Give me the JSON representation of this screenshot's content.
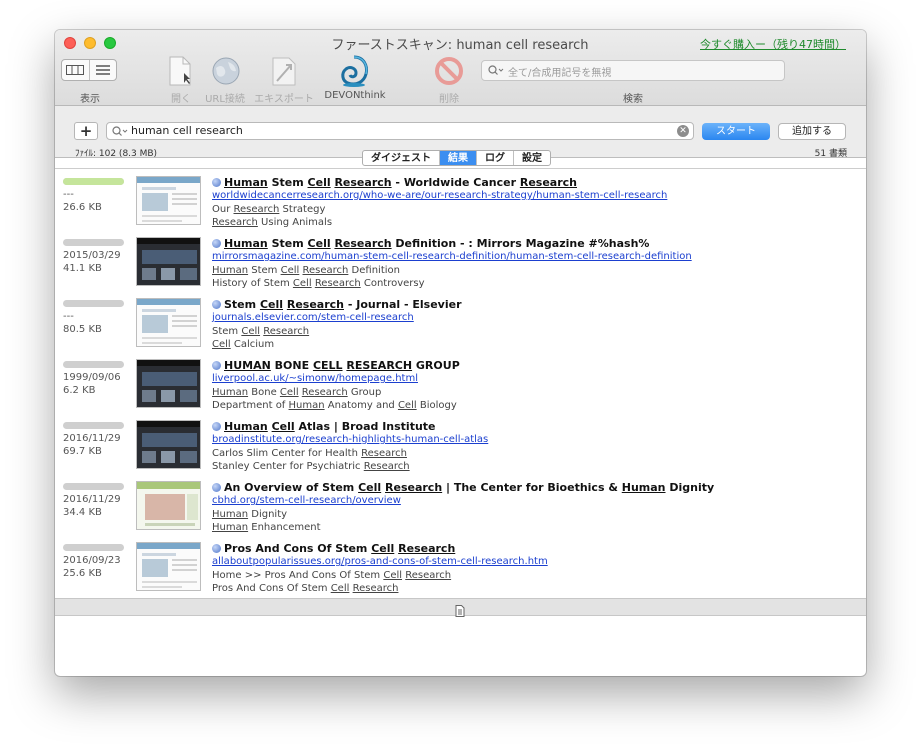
{
  "window": {
    "title": "ファーストスキャン: human cell research",
    "buy_link": "今すぐ購入ー（残り47時間）"
  },
  "toolbar": {
    "view_label": "表示",
    "open_label": "開く",
    "url_label": "URL接続",
    "export_label": "エキスポート",
    "devonthink_label": "DEVONthink",
    "delete_label": "削除",
    "search_label": "検索",
    "search_placeholder": "全て/合成用記号を無視"
  },
  "query": {
    "plus": "+",
    "value": "human cell research",
    "start": "スタート",
    "add": "追加する",
    "file_info": "ﾌｧｲﾙ: 102 (8.3 MB)",
    "count": "51 書類"
  },
  "tabs": [
    "ダイジェスト",
    "結果",
    "ログ",
    "設定"
  ],
  "active_tab": "結果",
  "results": [
    {
      "relevance": 1.0,
      "date": "---",
      "size": "26.6 KB",
      "title": "Human Stem Cell Research - Worldwide Cancer Research",
      "url": "worldwidecancerresearch.org/who-we-are/our-research-strategy/human-stem-cell-research",
      "line1": "Our Research Strategy",
      "line2": "Research Using Animals",
      "thumb": "light"
    },
    {
      "relevance": 0.0,
      "date": "2015/03/29",
      "size": "41.1 KB",
      "title": "Human Stem Cell Research Definition - : Mirrors Magazine #%hash%",
      "url": "mirrorsmagazine.com/human-stem-cell-research-definition/human-stem-cell-research-definition",
      "line1": "Human Stem Cell Research Definition",
      "line2": "History of Stem Cell Research Controversy",
      "thumb": "dark"
    },
    {
      "relevance": 0.0,
      "date": "---",
      "size": "80.5 KB",
      "title": "Stem Cell Research - Journal - Elsevier",
      "url": "journals.elsevier.com/stem-cell-research",
      "line1": "Stem Cell Research",
      "line2": "Cell Calcium",
      "thumb": "light"
    },
    {
      "relevance": 0.0,
      "date": "1999/09/06",
      "size": "6.2 KB",
      "title": "HUMAN BONE CELL RESEARCH GROUP",
      "url": "liverpool.ac.uk/~simonw/homepage.html",
      "line1": "Human Bone Cell Research Group",
      "line2": "Department of Human Anatomy and Cell Biology",
      "thumb": "dark"
    },
    {
      "relevance": 0.0,
      "date": "2016/11/29",
      "size": "69.7 KB",
      "title": "Human Cell Atlas | Broad Institute",
      "url": "broadinstitute.org/research-highlights-human-cell-atlas",
      "line1": "Carlos Slim Center for Health Research",
      "line2": "Stanley Center for Psychiatric Research",
      "thumb": "dark"
    },
    {
      "relevance": 0.0,
      "date": "2016/11/29",
      "size": "34.4 KB",
      "title": "An Overview of Stem Cell Research | The Center for Bioethics & Human Dignity",
      "url": "cbhd.org/stem-cell-research/overview",
      "line1": "Human Dignity",
      "line2": "Human Enhancement",
      "thumb": "green"
    },
    {
      "relevance": 0.0,
      "date": "2016/09/23",
      "size": "25.6 KB",
      "title": "Pros And Cons Of Stem Cell Research",
      "url": "allaboutpopularissues.org/pros-and-cons-of-stem-cell-research.htm",
      "line1": "Home >> Pros And Cons Of Stem Cell Research",
      "line2": "Pros And Cons Of Stem Cell Research",
      "thumb": "light"
    }
  ],
  "colors": {
    "accent": "#2a86f0",
    "link": "#1b3fcf",
    "relevance": "#c5e59b",
    "buy_link": "#1f8a2c"
  }
}
